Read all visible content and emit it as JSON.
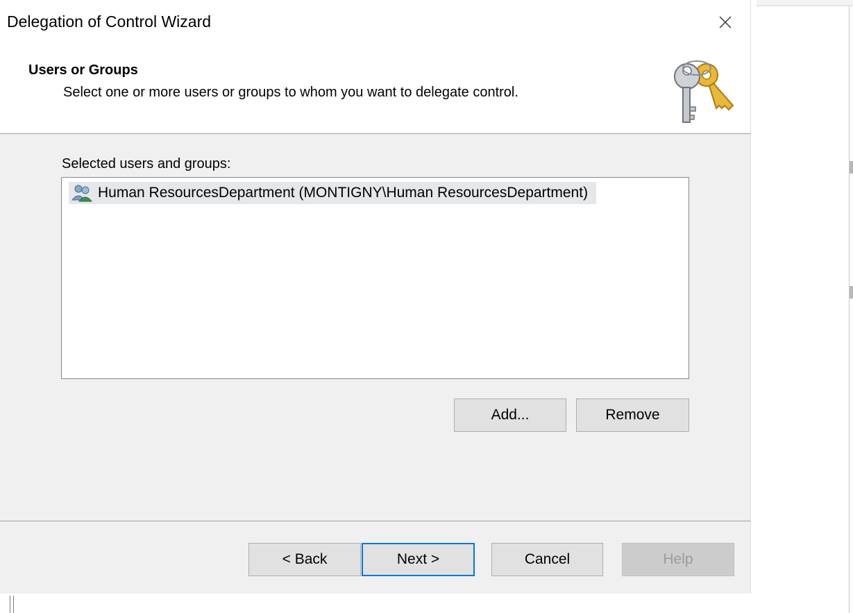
{
  "window": {
    "title": "Delegation of Control Wizard",
    "close_icon": "close-icon"
  },
  "header": {
    "title": "Users or Groups",
    "subtitle": "Select one or more users or groups to whom you want to delegate control.",
    "icon": "keys-icon"
  },
  "selected_list": {
    "label": "Selected users and groups:",
    "items": [
      {
        "icon": "group-icon",
        "text": "Human ResourcesDepartment (MONTIGNY\\Human ResourcesDepartment)"
      }
    ]
  },
  "list_buttons": {
    "add_label": "Add...",
    "remove_label": "Remove"
  },
  "footer": {
    "back_label": "< Back",
    "next_label": "Next >",
    "cancel_label": "Cancel",
    "help_label": "Help"
  },
  "colors": {
    "dialog_background": "#f0f0f0",
    "focus_border": "#0078d7",
    "selection_background": "#e5e7ea"
  }
}
